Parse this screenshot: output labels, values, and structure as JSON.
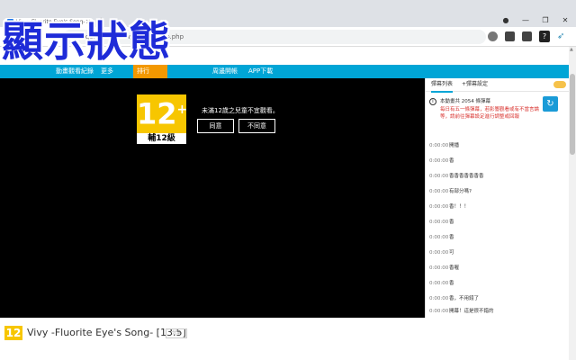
{
  "browser": {
    "tab_title": "Vivy -Fluorite Eye's Song-",
    "tab_close": "×",
    "new_tab": "+",
    "window_controls": [
      "●",
      "—",
      "❐",
      "✕"
    ],
    "url": "ani.gamer.com.tw/animeVideo.php"
  },
  "overlay_heading": "顯示狀態",
  "site_nav": {
    "items": [
      "動畫",
      "觀看紀錄",
      "更多",
      "排行",
      "周邊開帳",
      "APP下載"
    ]
  },
  "player": {
    "rating_number": "12",
    "rating_plus": "+",
    "rating_label": "輔12級",
    "notice": "未滿12歲之兒童不宜觀看。",
    "agree_button": "同意",
    "disagree_button": "不同意"
  },
  "danmaku_panel": {
    "tabs": [
      "彈幕列表",
      "+彈幕設定"
    ],
    "info_head": "本動畫共 2054 條彈幕",
    "info_body": "每日有五一條彈幕，若影響觀看或有不當言論等，請前往彈幕設定進行調整或回報",
    "refresh_icon": "↻",
    "rows": [
      {
        "time": "0:00:00",
        "text": "開播"
      },
      {
        "time": "0:00:00",
        "text": "香"
      },
      {
        "time": "0:00:00",
        "text": "香香香香香香香"
      },
      {
        "time": "0:00:00",
        "text": "有部分嗎?"
      },
      {
        "time": "0:00:00",
        "text": "香！！！"
      },
      {
        "time": "0:00:00",
        "text": "香"
      },
      {
        "time": "0:00:00",
        "text": "香"
      },
      {
        "time": "0:00:00",
        "text": "可"
      },
      {
        "time": "0:00:00",
        "text": "香喔"
      },
      {
        "time": "0:00:00",
        "text": "香"
      },
      {
        "time": "0:00:00",
        "text": "香，不用錢了"
      },
      {
        "time": "0:00:00",
        "text": "開幕！這是很不錯的"
      }
    ]
  },
  "bottom": {
    "mini_badge": "12",
    "title": "Vivy -Fluorite Eye's Song- [13.5]",
    "tag": "分享"
  },
  "colors": {
    "nav_blue": "#00a5d6",
    "nav_orange": "#f39800",
    "rating_yellow": "#f7c600",
    "overlay_blue": "#1e2bd8",
    "info_red": "#d9332f"
  }
}
